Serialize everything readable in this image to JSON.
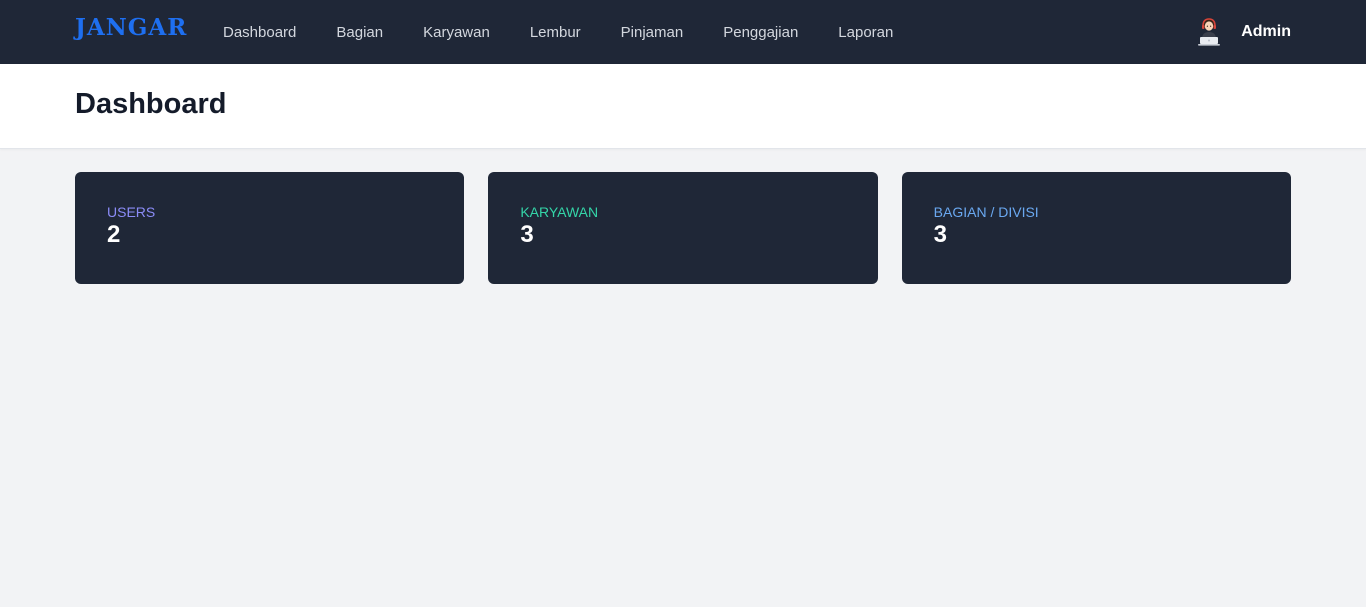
{
  "app": {
    "logo_text": "JANGAR",
    "logo_color": "#1e6ff0"
  },
  "nav": {
    "items": [
      {
        "label": "Dashboard"
      },
      {
        "label": "Bagian"
      },
      {
        "label": "Karyawan"
      },
      {
        "label": "Lembur"
      },
      {
        "label": "Pinjaman"
      },
      {
        "label": "Penggajian"
      },
      {
        "label": "Laporan"
      }
    ]
  },
  "user": {
    "name": "Admin",
    "avatar_icon": "user-avatar-icon"
  },
  "page": {
    "title": "Dashboard"
  },
  "stats": [
    {
      "label": "USERS",
      "value": "2",
      "color": "#8b8cf7"
    },
    {
      "label": "KARYAWAN",
      "value": "3",
      "color": "#34d5a8"
    },
    {
      "label": "BAGIAN / DIVISI",
      "value": "3",
      "color": "#6aa8f0"
    }
  ],
  "colors": {
    "navbar_bg": "#1f2737",
    "card_bg": "#1f2737",
    "page_bg": "#f2f3f5"
  }
}
